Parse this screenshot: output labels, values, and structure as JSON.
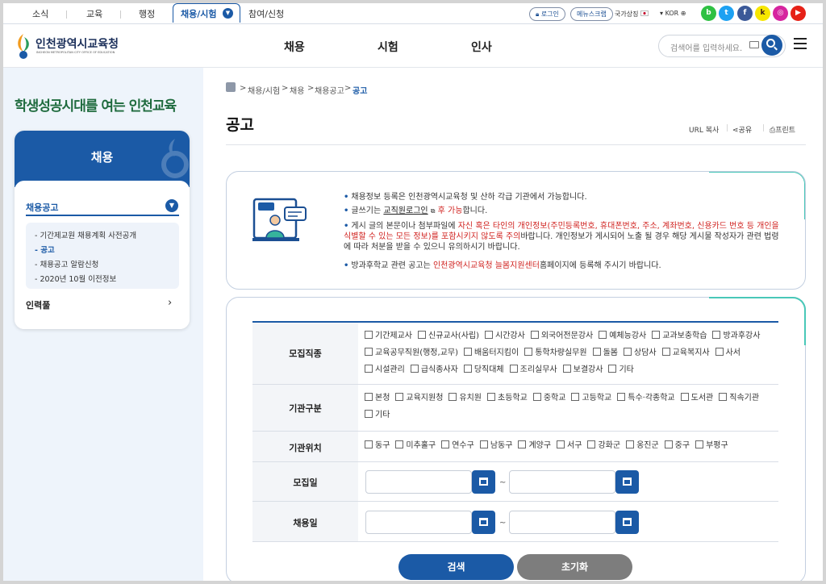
{
  "top_tabs": [
    "소식",
    "교육",
    "행정",
    "채용/시험",
    "참여/신청"
  ],
  "util": {
    "login": "로그인",
    "newsletter": "메뉴스크랩",
    "national_symbol": "국가상징",
    "lang": "KOR"
  },
  "logo": {
    "name": "인천광역시교육청",
    "sub": "INCHEON METROPOLITAN CITY OFFICE OF EDUCATION"
  },
  "gnb": [
    "채용",
    "시험",
    "인사"
  ],
  "search": {
    "placeholder": "검색어를 입력하세요."
  },
  "slogan": "학생성공시대를 여는 인천교육",
  "lnb": {
    "title": "채용",
    "section": "채용공고",
    "items": [
      "기간제교원 채용계획 사전공개",
      "공고",
      "채용공고 알람신청",
      "2020년 10월 이전정보"
    ],
    "active_item": "공고",
    "other": "인력풀"
  },
  "breadcrumb": [
    "채용/시험",
    "채용",
    "채용공고",
    "공고"
  ],
  "page_title": "공고",
  "tools": {
    "url_copy": "URL 복사",
    "share": "공유",
    "print": "프린트"
  },
  "notice": {
    "l1": "채용정보 등록은 인천광역시교육청 및 산하 각급 기관에서 가능합니다.",
    "l2_pre": "글쓰기는 ",
    "l2_link": "교직원로그인",
    "l2_red": " 후 가능",
    "l2_post": "합니다.",
    "l3_pre": "게시 글의 본문이나 첨부파일에 ",
    "l3_red": "자신 혹은 타인의 개인정보(주민등록번호, 휴대폰번호, 주소, 계좌번호, 신용카드 번호 등 개인을 식별할 수 있는 모든 정보)를 포함시키지 않도록 주의",
    "l3_post": "바랍니다. 개인정보가 게시되어 노출 될 경우 해당 게시물 작성자가 관련 법령에 따라 처분을 받을 수 있으니 유의하시기 바랍니다.",
    "l4_pre": "방과후학교 관련 공고는 ",
    "l4_red": "인천광역시교육청 늘봄지원센터",
    "l4_post": "홈페이지에 등록해 주시기 바랍니다."
  },
  "form": {
    "job_type": {
      "label": "모집직종",
      "options": [
        "기간제교사",
        "신규교사(사립)",
        "시간강사",
        "외국어전문강사",
        "예체능강사",
        "교과보충학습",
        "방과후강사",
        "교육공무직원(행정,교무)",
        "배움터지킴이",
        "통학차량실무원",
        "돌봄",
        "상담사",
        "교육복지사",
        "사서",
        "시설관리",
        "급식종사자",
        "당직대체",
        "조리실무사",
        "보결강사",
        "기타"
      ]
    },
    "org_type": {
      "label": "기관구분",
      "options": [
        "본청",
        "교육지원청",
        "유치원",
        "초등학교",
        "중학교",
        "고등학교",
        "특수·각종학교",
        "도서관",
        "직속기관",
        "기타"
      ]
    },
    "location": {
      "label": "기관위치",
      "options": [
        "동구",
        "미추홀구",
        "연수구",
        "남동구",
        "계양구",
        "서구",
        "강화군",
        "옹진군",
        "중구",
        "부평구"
      ]
    },
    "recruit_date": {
      "label": "모집일",
      "tilde": "~"
    },
    "hire_date": {
      "label": "채용일",
      "tilde": "~"
    }
  },
  "buttons": {
    "search": "검색",
    "reset": "초기화"
  },
  "colors": {
    "brand_blue": "#1b5aa6",
    "accent_red": "#d0221f",
    "teal": "#49c8b8"
  }
}
